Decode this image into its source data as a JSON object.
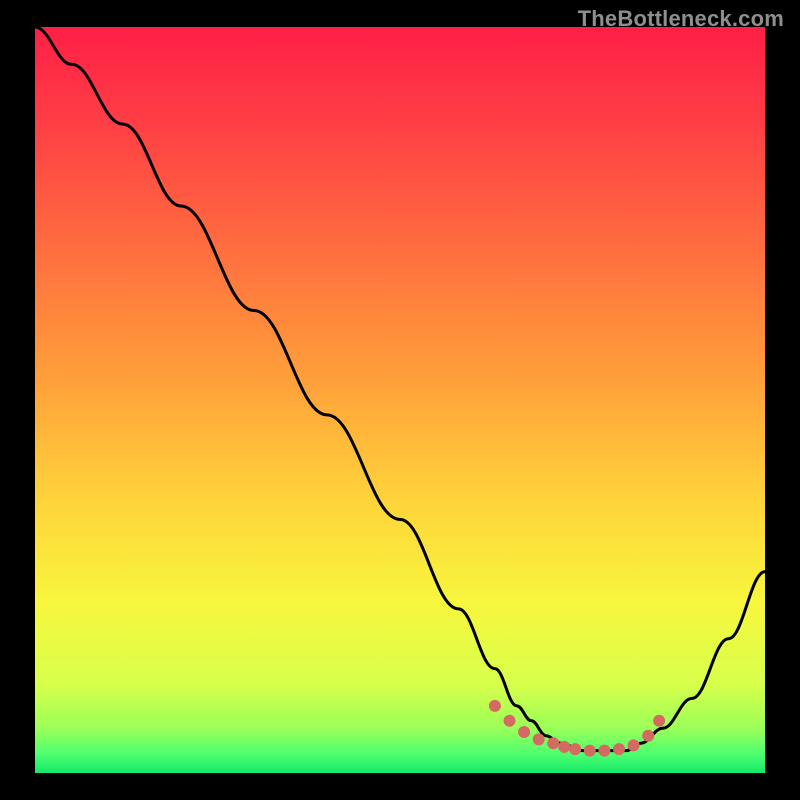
{
  "watermark": "TheBottleneck.com",
  "colors": {
    "bg": "#000000",
    "curve": "#000000",
    "dot_fill": "#d46a61",
    "gradient_stops": [
      {
        "offset": 0.0,
        "color": "#ff1f47"
      },
      {
        "offset": 0.12,
        "color": "#ff3c45"
      },
      {
        "offset": 0.3,
        "color": "#ff6e3f"
      },
      {
        "offset": 0.48,
        "color": "#ffa23a"
      },
      {
        "offset": 0.63,
        "color": "#ffd23a"
      },
      {
        "offset": 0.77,
        "color": "#f8f63d"
      },
      {
        "offset": 0.88,
        "color": "#d8ff4a"
      },
      {
        "offset": 0.94,
        "color": "#9bff58"
      },
      {
        "offset": 0.975,
        "color": "#4cff6f"
      },
      {
        "offset": 1.0,
        "color": "#16e86b"
      }
    ]
  },
  "chart_data": {
    "type": "line",
    "title": "",
    "xlabel": "",
    "ylabel": "",
    "xlim": [
      0,
      100
    ],
    "ylim": [
      0,
      100
    ],
    "grid": false,
    "legend": false,
    "series": [
      {
        "name": "bottleneck-curve",
        "x": [
          0,
          5,
          12,
          20,
          30,
          40,
          50,
          58,
          63,
          66,
          68,
          70,
          72,
          75,
          78,
          81,
          83,
          86,
          90,
          95,
          100
        ],
        "values": [
          100,
          95,
          87,
          76,
          62,
          48,
          34,
          22,
          14,
          9,
          7,
          5,
          4,
          3,
          3,
          3,
          4,
          6,
          10,
          18,
          27
        ]
      }
    ],
    "dots": {
      "name": "trough-markers",
      "x": [
        63,
        65,
        67,
        69,
        71,
        72.5,
        74,
        76,
        78,
        80,
        82,
        84,
        85.5
      ],
      "values": [
        9,
        7,
        5.5,
        4.5,
        4,
        3.5,
        3.2,
        3,
        3,
        3.2,
        3.7,
        5,
        7
      ]
    }
  }
}
